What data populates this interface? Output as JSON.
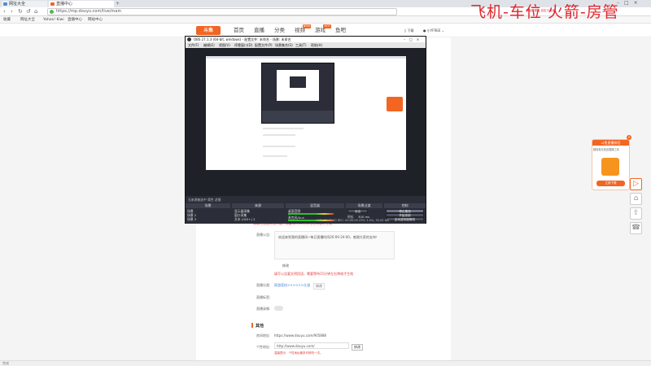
{
  "browser": {
    "tabs": [
      {
        "label": "网址大全",
        "color": "#4a90d9",
        "active": false
      },
      {
        "label": "直播中心",
        "color": "#f26522",
        "active": true
      }
    ],
    "url": "https://mp.douyu.com/live/main",
    "bookmarks": [
      "收藏",
      "网址大全",
      "Yahoo! Kiwi",
      "直播中心",
      "网站中心"
    ]
  },
  "header": {
    "logo": "斗鱼",
    "nav": [
      {
        "label": "首页"
      },
      {
        "label": "直播"
      },
      {
        "label": "分类"
      },
      {
        "label": "视频",
        "badge": "NEW"
      },
      {
        "label": "游戏",
        "badge": "HOT"
      },
      {
        "label": "鱼吧"
      }
    ],
    "download": "下载",
    "user": "小YFREE"
  },
  "overlay": {
    "big": "飞机-车位  火箭-房管",
    "small": "初始化模板 自定义背景"
  },
  "obs": {
    "title": "OBS 27.1.3 (64-bit, windows) - 配置文件: 未命名 - 场景: 未命名",
    "menu": [
      "文件(F)",
      "编辑(E)",
      "视图(V)",
      "停靠窗口(D)",
      "配置文件(P)",
      "场景集合(S)",
      "工具(T)",
      "帮助(H)"
    ],
    "docks": [
      "场景",
      "来源",
      "混音器",
      "场景过渡",
      "控制"
    ],
    "scenes": [
      "场景",
      "场景 2",
      "场景 3"
    ],
    "sources": [
      "显示器采集",
      "窗口采集",
      "图片",
      "媒体源",
      "文本 (GDI+) 2"
    ],
    "mixer": [
      "桌面音频",
      "麦克风/Aux",
      "媒体源"
    ],
    "transition": {
      "type": "淡出",
      "duration_label": "时长",
      "duration": "300 ms"
    },
    "controls": [
      "停止推流",
      "开始录制",
      "启动虚拟摄像机",
      "工作室模式",
      "设置",
      "退出"
    ],
    "status": "LIVE: 00:00:00   REC: 00:00:00   CPU: 1.0%, 30.00 fps",
    "meta_bar": "无来源被选中   属性   滤镜"
  },
  "form": {
    "notice_red": "请填写直播公告内容，需要等待15分钟左右审核才生效",
    "announce_label": "直播公告:",
    "announce_text": "欢迎来到我的直播间~每日直播时间20:00-24:00，感谢大家的支持！",
    "modify": "修改",
    "announce_red": "填写公告要文明用语，需要等待15分钟左右审核才生效",
    "category_label": "直播分类:",
    "category_value": "网游竞技>>>>>>久游",
    "category_btn": "修改",
    "tag_label": "直播标签:",
    "record_label": "直播录像:",
    "other_title": "其他",
    "room_label": "房间地址:",
    "room_value": "https://www.douyu.com/905888",
    "custom_label": "个性地址:",
    "custom_value": "http://www.douyu.com/",
    "custom_btn": "修改",
    "custom_red": "温馨提示：个性地址最多可修改一次。"
  },
  "promo": {
    "title": "斗鱼直播伴侣",
    "subtitle": "超轻松无延迟直播工具",
    "button": "立即下载"
  },
  "statusbar": "完成"
}
